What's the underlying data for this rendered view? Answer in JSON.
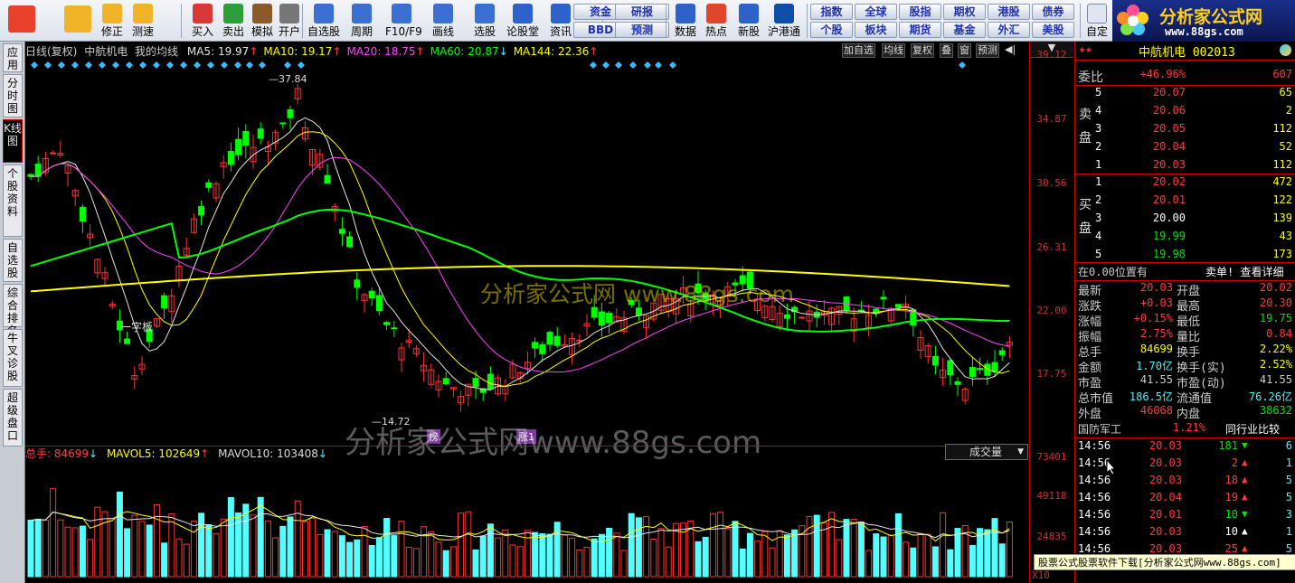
{
  "toolbar": {
    "left_buttons": [
      {
        "label": "",
        "icon": "windows-icon"
      },
      {
        "label": "",
        "icon": "back-arrow-icon"
      },
      {
        "label": "修正",
        "icon": "updown-arrow-icon"
      },
      {
        "label": "测速",
        "icon": "speed-test-icon"
      },
      {
        "label": "买入",
        "icon": "buy-icon"
      },
      {
        "label": "卖出",
        "icon": "sell-icon"
      },
      {
        "label": "模拟",
        "icon": "hammer-icon"
      },
      {
        "label": "开户",
        "icon": "lock-icon"
      },
      {
        "label": "自选股",
        "icon": "watchlist-icon"
      },
      {
        "label": "周期",
        "icon": "clock-icon"
      },
      {
        "label": "F10/F9",
        "icon": "f10-icon"
      },
      {
        "label": "画线",
        "icon": "pen-icon"
      },
      {
        "label": "选股",
        "icon": "select-stock-icon"
      },
      {
        "label": "论股堂",
        "icon": "forum-icon"
      },
      {
        "label": "资讯",
        "icon": "news-icon"
      }
    ],
    "small_buttons_1": [
      "资金",
      "研报",
      "BBD",
      "预测"
    ],
    "mid_buttons": [
      {
        "label": "数据",
        "icon": "pe-icon"
      },
      {
        "label": "热点",
        "icon": "hot-icon"
      },
      {
        "label": "新股",
        "icon": "new-stock-icon"
      },
      {
        "label": "沪港通",
        "icon": "sse-hkex-icon"
      }
    ],
    "small_buttons_2": [
      "指数",
      "全球",
      "股指",
      "期权",
      "港股",
      "债券",
      "个股",
      "板块",
      "期货",
      "基金",
      "外汇",
      "美股"
    ],
    "custom_label": "自定",
    "logo_text": "分析家公式网",
    "logo_url": "www.88gs.com"
  },
  "left_tabs": [
    "应用",
    "分时图",
    "K线图",
    "个股资料",
    "自选股",
    "综合排名",
    "牛叉诊股",
    "超级盘口"
  ],
  "chart": {
    "header_title": "日线(复权)",
    "stock_name": "中航机电",
    "indicator_name": "我的均线",
    "ma_labels": [
      {
        "text": "MA5: 19.97",
        "arrow": "↑",
        "color": "#e6e6e6"
      },
      {
        "text": "MA10: 19.17",
        "arrow": "↑",
        "color": "#ffff00"
      },
      {
        "text": "MA20: 18.75",
        "arrow": "↑",
        "color": "#ff44ff"
      },
      {
        "text": "MA60: 20.87",
        "arrow": "↓",
        "color": "#00ff00"
      },
      {
        "text": "MA144: 22.36",
        "arrow": "↑",
        "color": "#ffff00"
      }
    ],
    "header_buttons": [
      "加自选",
      "均线",
      "复权",
      "叠",
      "窗",
      "预测"
    ],
    "high_label": "37.84",
    "low_label": "14.72",
    "annot_1": "一字板",
    "annot_2": "榜",
    "annot_3": "涨1",
    "volume_header": "总手: 84699",
    "mavol5": "MAVOL5: 102649",
    "mavol10": "MAVOL10: 103408",
    "volume_select": "成交量",
    "price_axis": [
      "39.12",
      "34.87",
      "30.56",
      "26.31",
      "22.00",
      "17.75"
    ],
    "volume_axis": [
      "73401",
      "49118",
      "24835"
    ],
    "volume_axis_unit": "X10",
    "watermark_1": "分析家公式网 www.88gs.com",
    "watermark_2": "分析家公式网www.88gs.com"
  },
  "panel": {
    "title": "中航机电 002013",
    "wei_bi_label": "委比",
    "wei_bi_value": "+46.96%",
    "wei_cha": "607",
    "sell_label": "卖盘",
    "buy_label": "买盘",
    "sell_orders": [
      {
        "n": "5",
        "price": "20.07",
        "vol": "65"
      },
      {
        "n": "4",
        "price": "20.06",
        "vol": "2"
      },
      {
        "n": "3",
        "price": "20.05",
        "vol": "112"
      },
      {
        "n": "2",
        "price": "20.04",
        "vol": "52"
      },
      {
        "n": "1",
        "price": "20.03",
        "vol": "112"
      }
    ],
    "buy_orders": [
      {
        "n": "1",
        "price": "20.02",
        "vol": "472",
        "color": "red"
      },
      {
        "n": "2",
        "price": "20.01",
        "vol": "122",
        "color": "red"
      },
      {
        "n": "3",
        "price": "20.00",
        "vol": "139",
        "color": "wht"
      },
      {
        "n": "4",
        "price": "19.99",
        "vol": "43",
        "color": "grn"
      },
      {
        "n": "5",
        "price": "19.98",
        "vol": "173",
        "color": "grn"
      }
    ],
    "position_text": "在0.00位置有",
    "detail_link": "卖单! 查看详细",
    "stats": [
      {
        "l": "最新",
        "v": "20.03",
        "vc": "red",
        "l2": "开盘",
        "v2": "20.02",
        "v2c": "red"
      },
      {
        "l": "涨跌",
        "v": "+0.03",
        "vc": "red",
        "l2": "最高",
        "v2": "20.30",
        "v2c": "red"
      },
      {
        "l": "涨幅",
        "v": "+0.15%",
        "vc": "red",
        "l2": "最低",
        "v2": "19.75",
        "v2c": "grn"
      },
      {
        "l": "振幅",
        "v": "2.75%",
        "vc": "red",
        "l2": "量比",
        "v2": "0.84",
        "v2c": "red"
      },
      {
        "l": "总手",
        "v": "84699",
        "vc": "yel",
        "l2": "换手",
        "v2": "2.22%",
        "v2c": "yel"
      },
      {
        "l": "金额",
        "v": "1.70亿",
        "vc": "cyn",
        "l2": "换手(实)",
        "v2": "2.52%",
        "v2c": "yel"
      },
      {
        "l": "市盈",
        "v": "41.55",
        "vc": "gry",
        "l2": "市盈(动)",
        "v2": "41.55",
        "v2c": "gry"
      },
      {
        "l": "总市值",
        "v": "186.5亿",
        "vc": "cyn",
        "l2": "流通值",
        "v2": "76.26亿",
        "v2c": "cyn"
      },
      {
        "l": "外盘",
        "v": "46068",
        "vc": "red",
        "l2": "内盘",
        "v2": "38632",
        "v2c": "grn"
      }
    ],
    "sector_name": "国防军工",
    "sector_change": "1.21%",
    "sector_compare": "同行业比较",
    "ticks": [
      {
        "t": "14:56",
        "p": "20.03",
        "v": "181",
        "dir": "down",
        "n": "6"
      },
      {
        "t": "14:56",
        "p": "20.03",
        "v": "2",
        "dir": "up",
        "n": "1"
      },
      {
        "t": "14:56",
        "p": "20.03",
        "v": "18",
        "dir": "up",
        "n": "5"
      },
      {
        "t": "14:56",
        "p": "20.04",
        "v": "19",
        "dir": "up",
        "n": "5"
      },
      {
        "t": "14:56",
        "p": "20.01",
        "v": "10",
        "dir": "down",
        "n": "3"
      },
      {
        "t": "14:56",
        "p": "20.03",
        "v": "10",
        "dir": "up-white",
        "n": "1"
      },
      {
        "t": "14:56",
        "p": "20.03",
        "v": "25",
        "dir": "up",
        "n": "5"
      },
      {
        "t": "14:56",
        "p": "20.03",
        "v": "71",
        "dir": "up",
        "n": "1"
      }
    ]
  },
  "footer_text": "股票公式股票软件下载[分析家公式网www.88gs.com]",
  "colors": {
    "up": "#ff3232",
    "down": "#00ff00",
    "cyan_bar": "#54ffff",
    "ma5": "#e6e6e6",
    "ma10": "#ffff00",
    "ma20": "#ff44ff",
    "ma60": "#00ff00",
    "ma144": "#ffff00"
  }
}
